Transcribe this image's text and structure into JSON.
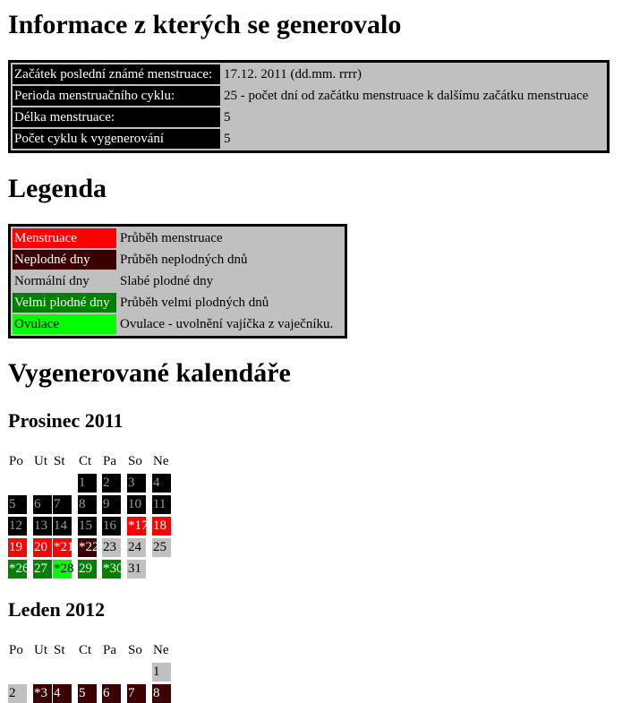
{
  "headings": {
    "info": "Informace z kterých se generovalo",
    "legend": "Legenda",
    "calendars": "Vygenerované kalendáře"
  },
  "info_rows": [
    {
      "label": "Začátek poslední známé menstruace:",
      "value": "17.12. 2011 (dd.mm. rrrr)"
    },
    {
      "label": "Perioda menstruačního cyklu:",
      "value": "25 - počet dní od začátku menstruace k dalšímu začátku menstruace"
    },
    {
      "label": "Délka menstruace:",
      "value": "5"
    },
    {
      "label": "Počet cyklu k vygenerování",
      "value": "5"
    }
  ],
  "legend_rows": [
    {
      "label": "Menstruace",
      "desc": "Průběh menstruace",
      "color": "#ff0000"
    },
    {
      "label": "Neplodné dny",
      "desc": "Průběh neplodných dnů",
      "color": "#3a0000"
    },
    {
      "label": "Normální dny",
      "desc": "Slabé plodné dny",
      "color": "#c0c0c0"
    },
    {
      "label": "Velmi plodné dny",
      "desc": "Průběh velmi plodných dnů",
      "color": "#008000"
    },
    {
      "label": "Ovulace",
      "desc": "Ovulace - uvolnění vajíčka z vaječníku.",
      "color": "#00ff00"
    }
  ],
  "weekdays": [
    "Po",
    "Ut",
    "St",
    "Ct",
    "Pa",
    "So",
    "Ne"
  ],
  "calendars": [
    {
      "title": "Prosinec 2011",
      "weeks": [
        [
          null,
          null,
          null,
          {
            "t": "1",
            "c": "black"
          },
          {
            "t": "2",
            "c": "black"
          },
          {
            "t": "3",
            "c": "black"
          },
          {
            "t": "4",
            "c": "black"
          }
        ],
        [
          {
            "t": "5",
            "c": "black"
          },
          {
            "t": "6",
            "c": "black"
          },
          {
            "t": "7",
            "c": "black"
          },
          {
            "t": "8",
            "c": "black"
          },
          {
            "t": "9",
            "c": "black"
          },
          {
            "t": "10",
            "c": "black"
          },
          {
            "t": "11",
            "c": "black"
          }
        ],
        [
          {
            "t": "12",
            "c": "black"
          },
          {
            "t": "13",
            "c": "black"
          },
          {
            "t": "14",
            "c": "black"
          },
          {
            "t": "15",
            "c": "black"
          },
          {
            "t": "16",
            "c": "black"
          },
          {
            "t": "*17",
            "c": "red"
          },
          {
            "t": "18",
            "c": "red"
          }
        ],
        [
          {
            "t": "19",
            "c": "red"
          },
          {
            "t": "20",
            "c": "red"
          },
          {
            "t": "*21",
            "c": "red"
          },
          {
            "t": "*22",
            "c": "dark"
          },
          {
            "t": "23",
            "c": "grey"
          },
          {
            "t": "24",
            "c": "grey"
          },
          {
            "t": "25",
            "c": "grey"
          }
        ],
        [
          {
            "t": "*26",
            "c": "green"
          },
          {
            "t": "27",
            "c": "green"
          },
          {
            "t": "*28",
            "c": "lime"
          },
          {
            "t": "29",
            "c": "green"
          },
          {
            "t": "*30",
            "c": "green"
          },
          {
            "t": "31",
            "c": "grey"
          },
          null
        ]
      ]
    },
    {
      "title": "Leden 2012",
      "weeks": [
        [
          null,
          null,
          null,
          null,
          null,
          null,
          {
            "t": "1",
            "c": "grey"
          }
        ],
        [
          {
            "t": "2",
            "c": "grey"
          },
          {
            "t": "*3",
            "c": "dark"
          },
          {
            "t": "4",
            "c": "dark"
          },
          {
            "t": "5",
            "c": "dark"
          },
          {
            "t": "6",
            "c": "dark"
          },
          {
            "t": "7",
            "c": "dark"
          },
          {
            "t": "8",
            "c": "dark"
          }
        ]
      ]
    }
  ]
}
